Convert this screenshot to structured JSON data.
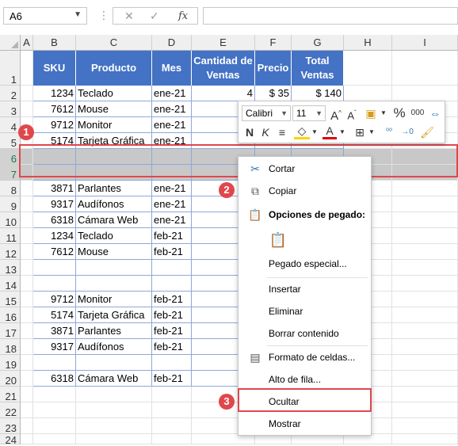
{
  "formula_bar": {
    "name_box": "A6",
    "fx": "fx",
    "formula": ""
  },
  "columns": [
    "A",
    "B",
    "C",
    "D",
    "E",
    "F",
    "G",
    "H",
    "I"
  ],
  "rows": [
    "1",
    "2",
    "3",
    "4",
    "5",
    "6",
    "7",
    "8",
    "9",
    "10",
    "11",
    "12",
    "13",
    "14",
    "15",
    "16",
    "17",
    "18",
    "19",
    "20",
    "21",
    "22",
    "23",
    "24"
  ],
  "table": {
    "headers": [
      "SKU",
      "Producto",
      "Mes",
      "Cantidad de Ventas",
      "Precio",
      "Total Ventas"
    ],
    "rows": [
      [
        "1234",
        "Teclado",
        "ene-21",
        "4",
        "$ 35",
        "$ 140"
      ],
      [
        "7612",
        "Mouse",
        "ene-21",
        "",
        "",
        ""
      ],
      [
        "9712",
        "Monitor",
        "ene-21",
        "",
        "",
        ""
      ],
      [
        "5174",
        "Tarjeta Gráfica",
        "ene-21",
        "",
        "",
        ""
      ],
      [
        "",
        "",
        "",
        "",
        "",
        ""
      ],
      [
        "",
        "",
        "",
        "",
        "",
        ""
      ],
      [
        "3871",
        "Parlantes",
        "ene-21",
        "",
        "",
        ""
      ],
      [
        "9317",
        "Audífonos",
        "ene-21",
        "",
        "",
        ""
      ],
      [
        "6318",
        "Cámara Web",
        "ene-21",
        "",
        "",
        ""
      ],
      [
        "1234",
        "Teclado",
        "feb-21",
        "",
        "",
        ""
      ],
      [
        "7612",
        "Mouse",
        "feb-21",
        "",
        "",
        ""
      ],
      [
        "",
        "",
        "",
        "",
        "",
        ""
      ],
      [
        "",
        "",
        "",
        "",
        "",
        ""
      ],
      [
        "9712",
        "Monitor",
        "feb-21",
        "",
        "",
        ""
      ],
      [
        "5174",
        "Tarjeta Gráfica",
        "feb-21",
        "",
        "",
        ""
      ],
      [
        "3871",
        "Parlantes",
        "feb-21",
        "",
        "",
        ""
      ],
      [
        "9317",
        "Audífonos",
        "feb-21",
        "",
        "",
        ""
      ],
      [
        "",
        "",
        "",
        "",
        "",
        ""
      ],
      [
        "6318",
        "Cámara Web",
        "feb-21",
        "",
        "",
        ""
      ]
    ]
  },
  "mini_toolbar": {
    "font": "Calibri",
    "size": "11",
    "bold": "N",
    "italic": "K",
    "percent": "%",
    "thousands": "000"
  },
  "context_menu": {
    "cut": "Cortar",
    "copy": "Copiar",
    "paste_options": "Opciones de pegado:",
    "paste_special": "Pegado especial...",
    "insert": "Insertar",
    "delete": "Eliminar",
    "clear": "Borrar contenido",
    "format_cells": "Formato de celdas...",
    "row_height": "Alto de fila...",
    "hide": "Ocultar",
    "unhide": "Mostrar"
  },
  "callouts": [
    "1",
    "2",
    "3"
  ],
  "colors": {
    "table_header": "#4472c4",
    "callout": "#e0474c",
    "selection": "#c8c8c8",
    "accent_green": "#217346"
  }
}
